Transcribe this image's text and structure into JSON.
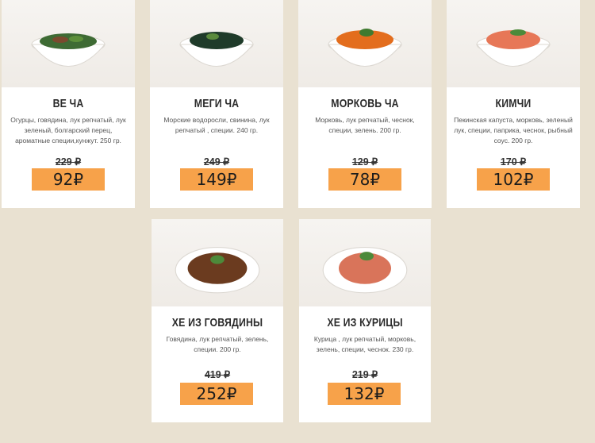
{
  "items": [
    {
      "title": "ВЕ ЧА",
      "description": "Огурцы, говядина, лук репчатый, лук зеленый, болгарский перец, ароматные специи,кунжут. 250 гр.",
      "old_price": "229 ₽",
      "price": "92₽",
      "food_color": "#3e6b34"
    },
    {
      "title": "МЕГИ ЧА",
      "description": "Морские водоросли, свинина, лук репчатый , специи. 240 гр.",
      "old_price": "249 ₽",
      "price": "149₽",
      "food_color": "#1f3b2a"
    },
    {
      "title": "МОРКОВЬ ЧА",
      "description": "Морковь, лук репчатый, чеснок, специи, зелень. 200 гр.",
      "old_price": "129 ₽",
      "price": "78₽",
      "food_color": "#e36d1d"
    },
    {
      "title": "КИМЧИ",
      "description": "Пекинская капуста, морковь, зеленый лук, специи, паприка, чеснок, рыбный соус. 200 гр.",
      "old_price": "170 ₽",
      "price": "102₽",
      "food_color": "#e77757"
    },
    {
      "title": "ХЕ ИЗ ГОВЯДИНЫ",
      "description": "Говядина, лук репчатый, зелень, специи. 200 гр.",
      "old_price": "419 ₽",
      "price": "252₽",
      "food_color": "#6b3b1f"
    },
    {
      "title": "ХЕ ИЗ КУРИЦЫ",
      "description": "Курица , лук репчатый, морковь, зелень, специи, чеснок. 230 гр.",
      "old_price": "219 ₽",
      "price": "132₽",
      "food_color": "#d9745a"
    }
  ],
  "colors": {
    "background": "#e9e1d1",
    "price_badge": "#f7a24a"
  }
}
